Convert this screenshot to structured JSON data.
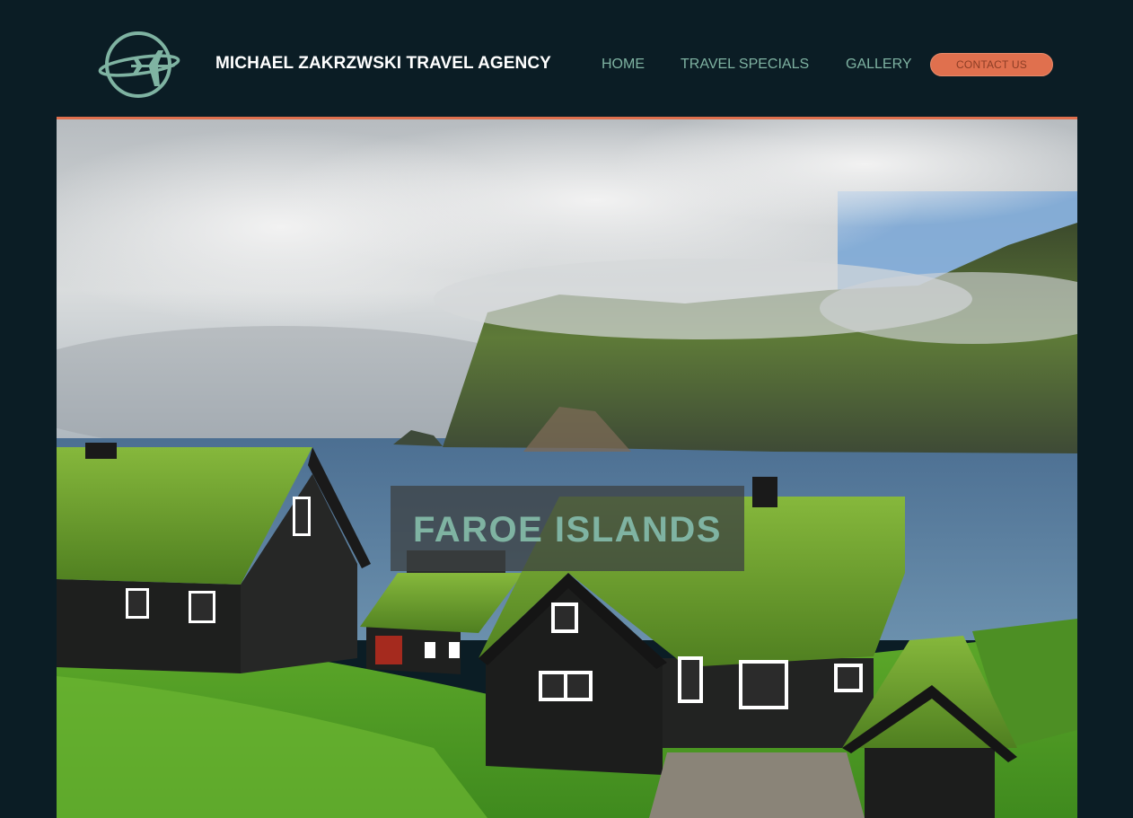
{
  "header": {
    "logo_icon": "plane-globe-icon",
    "brand": "MICHAEL ZAKRZWSKI TRAVEL AGENCY",
    "nav": {
      "home": "HOME",
      "travel_specials": "TRAVEL SPECIALS",
      "gallery": "GALLERY",
      "contact": "CONTACT US"
    }
  },
  "hero": {
    "title": "FAROE ISLANDS"
  },
  "colors": {
    "background": "#0b1d25",
    "accent": "#e0704e",
    "brand_green": "#7fb3a2"
  }
}
